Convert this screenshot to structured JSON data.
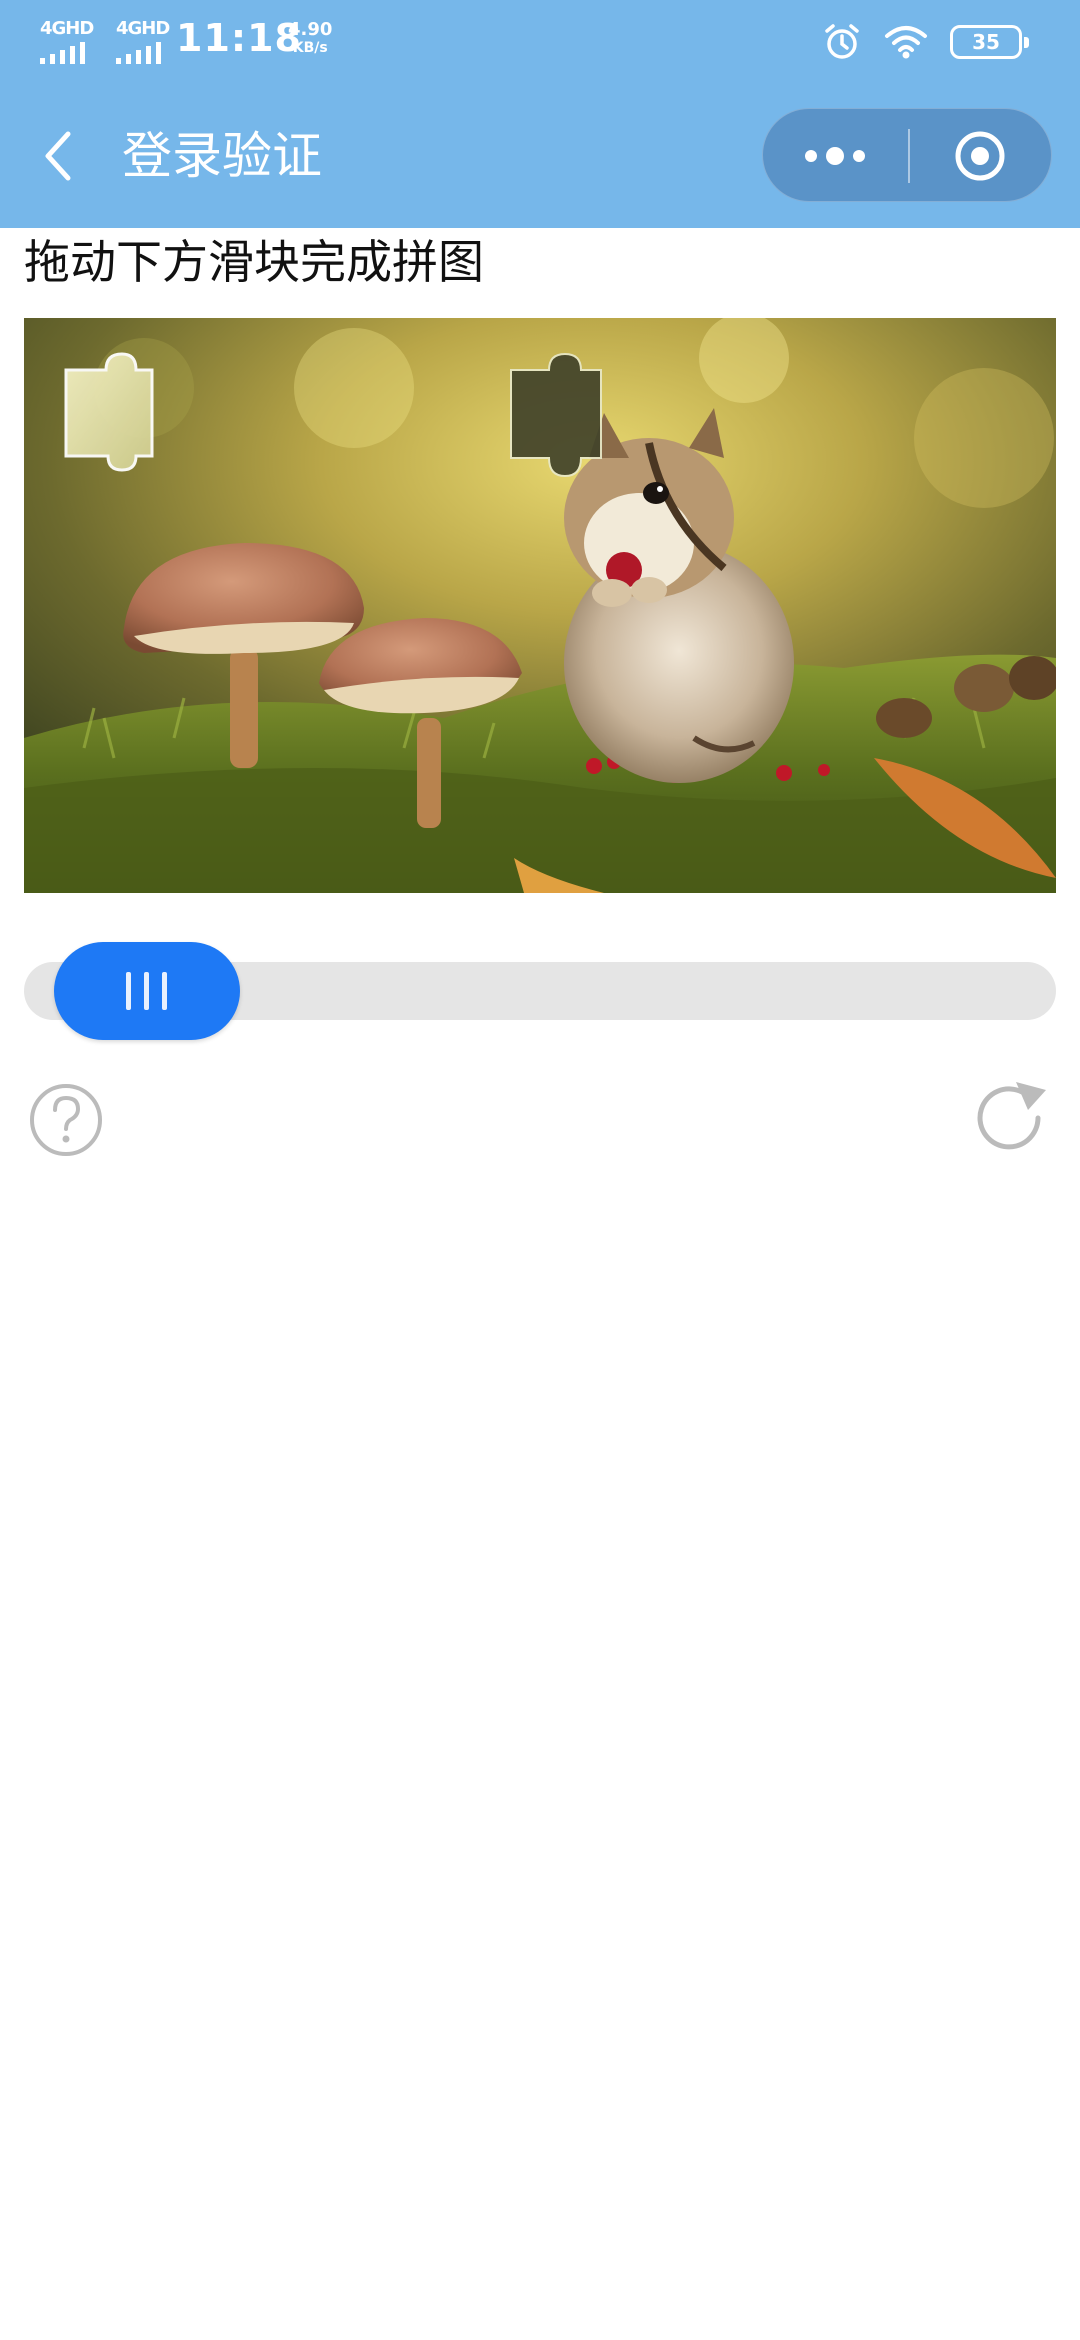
{
  "status_bar": {
    "network_1": "4GHD",
    "network_2": "4GHD",
    "time": "11:18",
    "speed_value": "4.90",
    "speed_unit": "KB/s",
    "battery": "35",
    "icons": [
      "alarm-icon",
      "wifi-icon",
      "battery-icon"
    ]
  },
  "nav": {
    "back_icon": "chevron-left-icon",
    "title": "登录验证",
    "menu_icon": "more-dots-icon",
    "close_icon": "target-close-icon"
  },
  "captcha": {
    "instruction": "拖动下方滑块完成拼图",
    "image_subject": "chipmunk-mushrooms-photo",
    "slider_progress": 0,
    "help_icon": "question-circle-icon",
    "refresh_icon": "refresh-icon"
  },
  "colors": {
    "header_bg": "#76b7ea",
    "capsule_bg": "#5a93c8",
    "slider_knob": "#1e79f5",
    "slider_track": "#e5e5e5",
    "icon_gray": "#bbbbbb"
  }
}
